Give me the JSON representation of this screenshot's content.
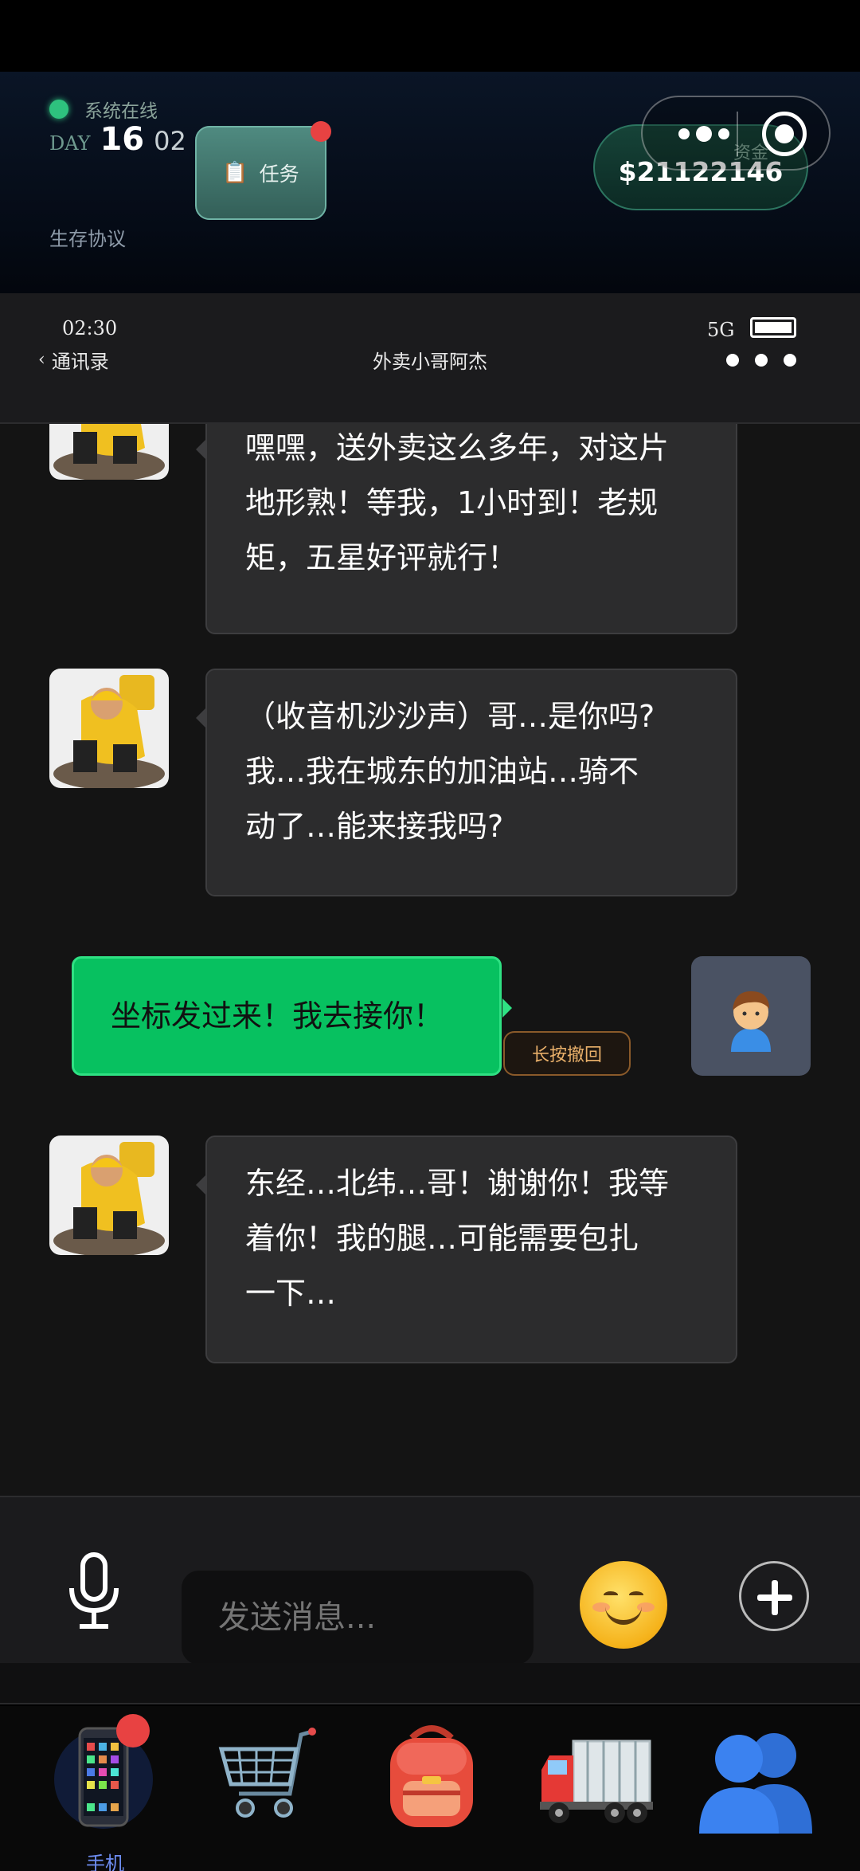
{
  "hud": {
    "status_text": "系统在线",
    "day_label": "DAY",
    "day_number": "16",
    "day_sub": "02",
    "protocol": "生存协议",
    "task_label": "任务",
    "funds_label": "资金",
    "funds_amount": "$21122146"
  },
  "phone_header": {
    "time": "02:30",
    "back_label": "通讯录",
    "contact_name": "外卖小哥阿杰",
    "network": "5G"
  },
  "messages": [
    {
      "from": "contact",
      "lines": [
        "嘿嘿，送外卖这么多年，对这片",
        "地形熟！等我，1小时到！老规",
        "矩，五星好评就行！"
      ]
    },
    {
      "from": "contact",
      "lines": [
        "（收音机沙沙声）哥…是你吗?",
        "我…我在城东的加油站…骑不",
        "动了…能来接我吗?"
      ]
    },
    {
      "from": "me",
      "lines": [
        "坐标发过来！我去接你！"
      ],
      "recall_label": "长按撤回"
    },
    {
      "from": "contact",
      "lines": [
        "东经…北纬…哥！谢谢你！我等",
        "着你！我的腿…可能需要包扎",
        "一下…"
      ]
    }
  ],
  "input": {
    "placeholder": "发送消息..."
  },
  "bottom_nav": {
    "items": [
      {
        "icon": "phone-icon",
        "label": "手机",
        "active": true,
        "badge": true
      },
      {
        "icon": "cart-icon",
        "label": ""
      },
      {
        "icon": "backpack-icon",
        "label": ""
      },
      {
        "icon": "truck-icon",
        "label": ""
      },
      {
        "icon": "people-icon",
        "label": ""
      }
    ]
  },
  "colors": {
    "accent_green": "#07c160",
    "badge_red": "#e84242",
    "online_green": "#2ec27e",
    "nav_active": "#6d8cf0"
  }
}
